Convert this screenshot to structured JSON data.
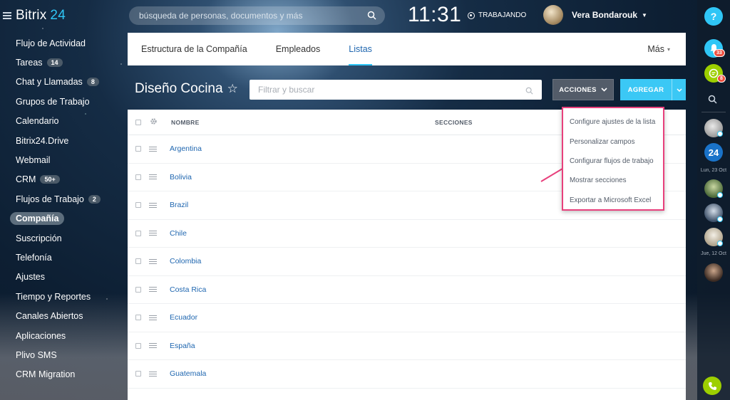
{
  "app": {
    "logo_name": "Bitrix",
    "logo_num": "24"
  },
  "sidebar": {
    "items": [
      {
        "label": "Flujo de Actividad",
        "badge": ""
      },
      {
        "label": "Tareas",
        "badge": "14"
      },
      {
        "label": "Chat y Llamadas",
        "badge": "8"
      },
      {
        "label": "Grupos de Trabajo",
        "badge": ""
      },
      {
        "label": "Calendario",
        "badge": ""
      },
      {
        "label": "Bitrix24.Drive",
        "badge": ""
      },
      {
        "label": "Webmail",
        "badge": ""
      },
      {
        "label": "CRM",
        "badge": "50+"
      },
      {
        "label": "Flujos de Trabajo",
        "badge": "2"
      },
      {
        "label": "Compañía",
        "badge": "",
        "active": true
      },
      {
        "label": "Suscripción",
        "badge": ""
      },
      {
        "label": "Telefonía",
        "badge": ""
      },
      {
        "label": "Ajustes",
        "badge": ""
      },
      {
        "label": "Tiempo y Reportes",
        "badge": ""
      },
      {
        "label": "Canales Abiertos",
        "badge": ""
      },
      {
        "label": "Aplicaciones",
        "badge": ""
      },
      {
        "label": "Plivo SMS",
        "badge": ""
      },
      {
        "label": "CRM Migration",
        "badge": ""
      }
    ]
  },
  "header": {
    "search_placeholder": "búsqueda de personas, documentos y más",
    "clock": "11:31",
    "status": "TRABAJANDO",
    "user_name": "Vera Bondarouk"
  },
  "tabs": {
    "items": [
      {
        "label": "Estructura de la Compañía",
        "active": false
      },
      {
        "label": "Empleados",
        "active": false
      },
      {
        "label": "Listas",
        "active": true
      }
    ],
    "more": "Más"
  },
  "page": {
    "title": "Diseño Cocina",
    "filter_placeholder": "Filtrar y buscar",
    "actions_label": "ACCIONES",
    "add_label": "AGREGAR"
  },
  "grid": {
    "columns": {
      "name": "NOMBRE",
      "sections": "SECCIONES"
    },
    "rows": [
      "Argentina",
      "Bolivia",
      "Brazil",
      "Chile",
      "Colombia",
      "Costa Rica",
      "Ecuador",
      "España",
      "Guatemala"
    ]
  },
  "actions_menu": {
    "items": [
      "Configure ajustes de la lista",
      "Personalizar campos",
      "Configurar flujos de trabajo",
      "Mostrar secciones",
      "Exportar a Microsoft Excel"
    ]
  },
  "rightbar": {
    "help": "?",
    "notifications_count": "33",
    "chat_count": "8",
    "app_badge": "24",
    "date_1": "Lun, 23 Oct",
    "date_2": "Jue, 12 Oct"
  },
  "colors": {
    "accent": "#2fc6f6",
    "highlight": "#e8407c",
    "link": "#2067b0"
  }
}
